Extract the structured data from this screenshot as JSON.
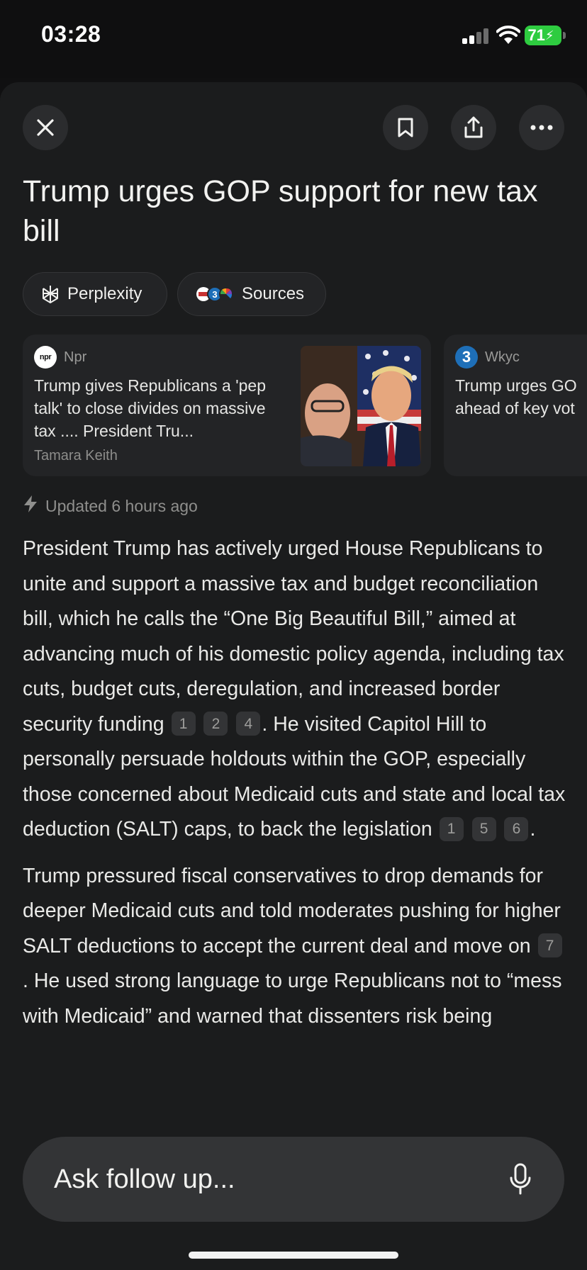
{
  "status_bar": {
    "time": "03:28",
    "battery": "71"
  },
  "header": {
    "title": "Trump urges GOP support for new tax bill"
  },
  "chips": [
    {
      "label": "Perplexity",
      "icon": "perplexity-logo-icon"
    },
    {
      "label": "Sources",
      "icon": "source-logos-icon"
    }
  ],
  "source_cards": [
    {
      "source": "Npr",
      "text": "Trump gives Republicans a 'pep talk' to close divides on massive tax .... President Tru...",
      "author": "Tamara Keith"
    },
    {
      "source": "Wkyc",
      "text_line1": "Trump urges GO",
      "text_line2": "ahead of key vot"
    }
  ],
  "updated": "Updated 6 hours ago",
  "article": {
    "p1_a": "President Trump has actively urged House Republicans to unite and support a massive tax and budget reconciliation bill, which he calls the “One Big Beautiful Bill,” aimed at advancing much of his domestic policy agenda, including tax cuts, budget cuts, deregulation, and increased border security funding",
    "c1": "1",
    "c2": "2",
    "c3": "4",
    "p1_b": ". He visited Capitol Hill to personally persuade holdouts within the GOP, especially those concerned about Medicaid cuts and state and local tax deduction (SALT) caps, to back the legislation",
    "c4": "1",
    "c5": "5",
    "c6": "6",
    "p1_c": ".",
    "p2_a": "Trump pressured fiscal conservatives to drop demands for deeper Medicaid cuts and told moderates pushing for higher SALT deductions to accept the current deal and move on",
    "c7": "7",
    "p2_b": ". He used strong language to urge Republicans not to “mess with Medicaid” and warned that dissenters risk being"
  },
  "ask": {
    "placeholder": "Ask follow up..."
  }
}
